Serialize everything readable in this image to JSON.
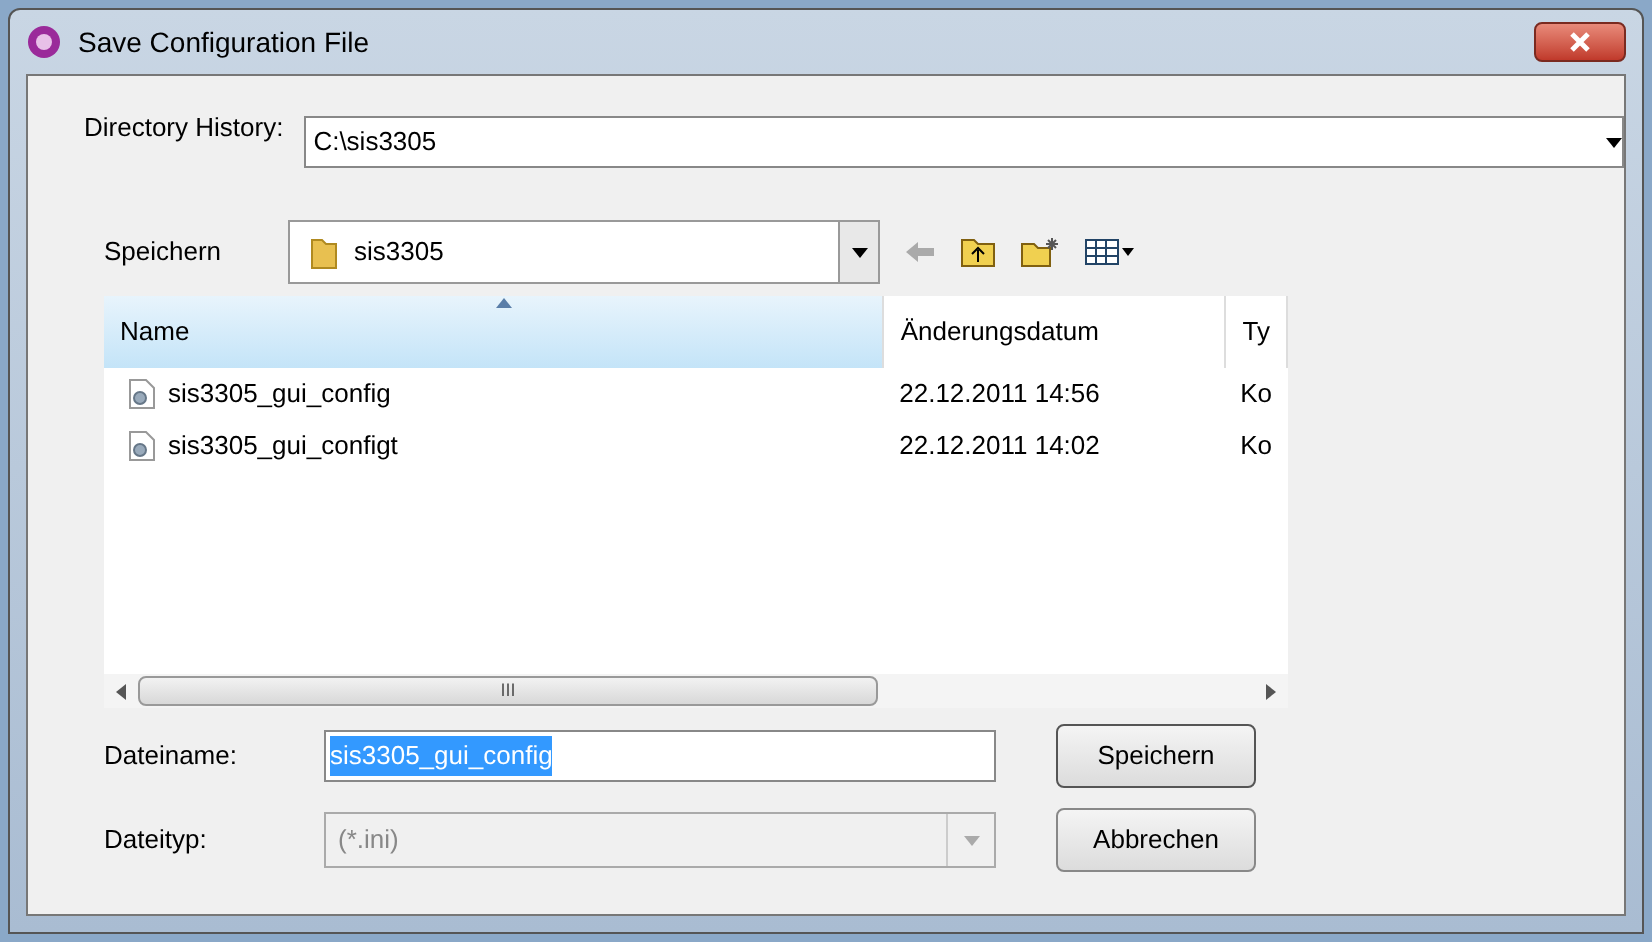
{
  "window": {
    "title": "Save Configuration File"
  },
  "directory_history": {
    "label": "Directory History:",
    "value": "C:\\sis3305"
  },
  "save_in": {
    "label": "Speichern",
    "folder": "sis3305"
  },
  "file_list": {
    "columns": [
      {
        "label": "Name",
        "sorted": true
      },
      {
        "label": "Änderungsdatum",
        "sorted": false
      },
      {
        "label": "Ty",
        "sorted": false
      }
    ],
    "rows": [
      {
        "name": "sis3305_gui_config",
        "date": "22.12.2011 14:56",
        "type": "Ko"
      },
      {
        "name": "sis3305_gui_configt",
        "date": "22.12.2011 14:02",
        "type": "Ko"
      }
    ]
  },
  "scrollbar": {
    "grip": "III"
  },
  "filename": {
    "label": "Dateiname:",
    "value": "sis3305_gui_config",
    "selected": true
  },
  "filetype": {
    "label": "Dateityp:",
    "value": "(*.ini)",
    "disabled": true
  },
  "buttons": [
    "Speichern",
    "Abbrechen"
  ]
}
